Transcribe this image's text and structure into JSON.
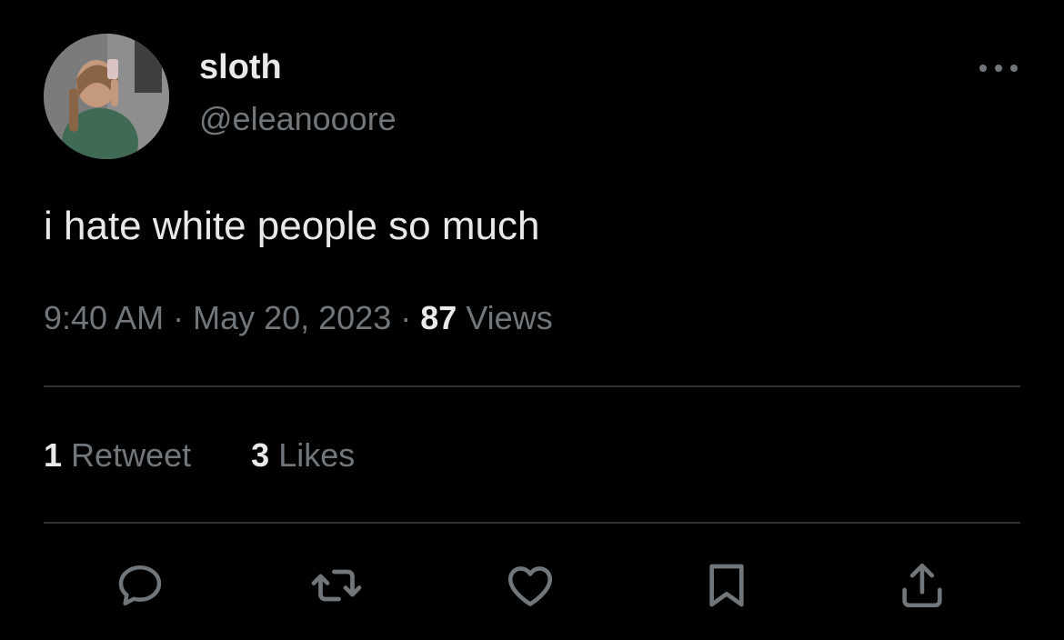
{
  "tweet": {
    "author": {
      "display_name": "sloth",
      "handle": "@eleanooore",
      "avatar_icon": "user-avatar-photo"
    },
    "text": "i hate white people so much",
    "time": "9:40 AM",
    "separator": "·",
    "date": "May 20, 2023",
    "views_count": "87",
    "views_label": "Views"
  },
  "stats": {
    "retweets_count": "1",
    "retweets_label": "Retweet",
    "likes_count": "3",
    "likes_label": "Likes"
  },
  "actions": [
    {
      "icon": "reply-icon"
    },
    {
      "icon": "retweet-icon"
    },
    {
      "icon": "like-heart-icon"
    },
    {
      "icon": "bookmark-icon"
    },
    {
      "icon": "share-icon"
    }
  ],
  "more_icon": "more-options-icon",
  "colors": {
    "background": "#000000",
    "primary_text": "#e7e9ea",
    "secondary_text": "#71767b",
    "divider": "#2f3336"
  }
}
